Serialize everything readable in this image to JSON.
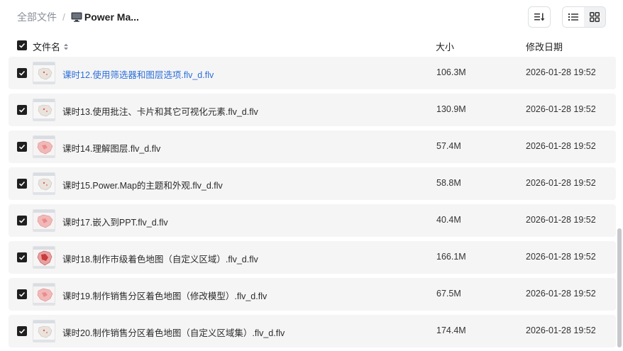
{
  "breadcrumb": {
    "root": "全部文件",
    "separator": "/",
    "current": "Power Ma..."
  },
  "toolbar": {
    "sort_icon": "sort-lines-icon",
    "view_list_icon": "list-view-icon",
    "view_grid_icon": "grid-view-icon"
  },
  "columns": {
    "name": "文件名",
    "size": "大小",
    "date": "修改日期"
  },
  "colors": {
    "link": "#2d6fd6",
    "row_bg": "#f5f5f6",
    "checkbox": "#1f1f1f"
  },
  "files": [
    {
      "name": "课时12.使用筛选器和图层选项.flv_d.flv",
      "size": "106.3M",
      "date": "2026-01-28 19:52",
      "hover": true,
      "thumb": "light"
    },
    {
      "name": "课时13.使用批注、卡片和其它可视化元素.flv_d.flv",
      "size": "130.9M",
      "date": "2026-01-28 19:52",
      "hover": false,
      "thumb": "light"
    },
    {
      "name": "课时14.理解图层.flv_d.flv",
      "size": "57.4M",
      "date": "2026-01-28 19:52",
      "hover": false,
      "thumb": "pink"
    },
    {
      "name": "课时15.Power.Map的主题和外观.flv_d.flv",
      "size": "58.8M",
      "date": "2026-01-28 19:52",
      "hover": false,
      "thumb": "light"
    },
    {
      "name": "课时17.嵌入到PPT.flv_d.flv",
      "size": "40.4M",
      "date": "2026-01-28 19:52",
      "hover": false,
      "thumb": "pink"
    },
    {
      "name": "课时18.制作市级着色地图（自定义区域）.flv_d.flv",
      "size": "166.1M",
      "date": "2026-01-28 19:52",
      "hover": false,
      "thumb": "red"
    },
    {
      "name": "课时19.制作销售分区着色地图（修改模型）.flv_d.flv",
      "size": "67.5M",
      "date": "2026-01-28 19:52",
      "hover": false,
      "thumb": "pink"
    },
    {
      "name": "课时20.制作销售分区着色地图（自定义区域集）.flv_d.flv",
      "size": "174.4M",
      "date": "2026-01-28 19:52",
      "hover": false,
      "thumb": "light"
    }
  ]
}
